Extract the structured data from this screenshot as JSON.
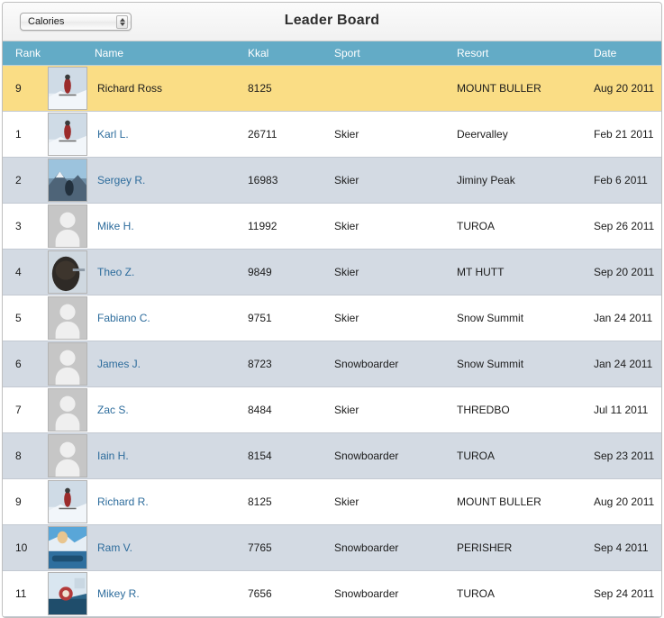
{
  "toolbar": {
    "filter_value": "Calories",
    "filter_options": [
      "Calories"
    ],
    "stepper_up_icon": "triangle-up-icon",
    "stepper_down_icon": "triangle-down-icon",
    "title": "Leader Board"
  },
  "table": {
    "columns": [
      {
        "key": "rank",
        "label": "Rank"
      },
      {
        "key": "name",
        "label": "Name"
      },
      {
        "key": "kkal",
        "label": "Kkal"
      },
      {
        "key": "sport",
        "label": "Sport"
      },
      {
        "key": "resort",
        "label": "Resort"
      },
      {
        "key": "date",
        "label": "Date"
      }
    ],
    "rows": [
      {
        "rank": "9",
        "name": "Richard Ross",
        "kkal": "8125",
        "sport": "",
        "resort": "MOUNT BULLER",
        "date": "Aug 20 2011",
        "avatar": "photo-skier",
        "highlight": true
      },
      {
        "rank": "1",
        "name": "Karl L.",
        "kkal": "26711",
        "sport": "Skier",
        "resort": "Deervalley",
        "date": "Feb 21 2011",
        "avatar": "photo-skier",
        "highlight": false
      },
      {
        "rank": "2",
        "name": "Sergey R.",
        "kkal": "16983",
        "sport": "Skier",
        "resort": "Jiminy Peak",
        "date": "Feb 6 2011",
        "avatar": "photo-mountain",
        "highlight": false
      },
      {
        "rank": "3",
        "name": "Mike H.",
        "kkal": "11992",
        "sport": "Skier",
        "resort": "TUROA",
        "date": "Sep 26 2011",
        "avatar": "default-avatar",
        "highlight": false
      },
      {
        "rank": "4",
        "name": "Theo Z.",
        "kkal": "9849",
        "sport": "Skier",
        "resort": "MT HUTT",
        "date": "Sep 20 2011",
        "avatar": "photo-portrait",
        "highlight": false
      },
      {
        "rank": "5",
        "name": "Fabiano C.",
        "kkal": "9751",
        "sport": "Skier",
        "resort": "Snow Summit",
        "date": "Jan 24 2011",
        "avatar": "default-avatar",
        "highlight": false
      },
      {
        "rank": "6",
        "name": "James J.",
        "kkal": "8723",
        "sport": "Snowboarder",
        "resort": "Snow Summit",
        "date": "Jan 24 2011",
        "avatar": "default-avatar",
        "highlight": false
      },
      {
        "rank": "7",
        "name": "Zac S.",
        "kkal": "8484",
        "sport": "Skier",
        "resort": "THREDBO",
        "date": "Jul 11 2011",
        "avatar": "default-avatar",
        "highlight": false
      },
      {
        "rank": "8",
        "name": "Iain H.",
        "kkal": "8154",
        "sport": "Snowboarder",
        "resort": "TUROA",
        "date": "Sep 23 2011",
        "avatar": "default-avatar",
        "highlight": false
      },
      {
        "rank": "9",
        "name": "Richard R.",
        "kkal": "8125",
        "sport": "Skier",
        "resort": "MOUNT BULLER",
        "date": "Aug 20 2011",
        "avatar": "photo-skier",
        "highlight": false
      },
      {
        "rank": "10",
        "name": "Ram V.",
        "kkal": "7765",
        "sport": "Snowboarder",
        "resort": "PERISHER",
        "date": "Sep 4 2011",
        "avatar": "photo-snowboard",
        "highlight": false
      },
      {
        "rank": "11",
        "name": "Mikey R.",
        "kkal": "7656",
        "sport": "Snowboarder",
        "resort": "TUROA",
        "date": "Sep 24 2011",
        "avatar": "photo-snowboard2",
        "highlight": false
      }
    ]
  },
  "colors": {
    "header_bg": "#63abc6",
    "highlight_row": "#fadd85",
    "alt_row": "#d3dae3",
    "link": "#2d6c9c"
  }
}
